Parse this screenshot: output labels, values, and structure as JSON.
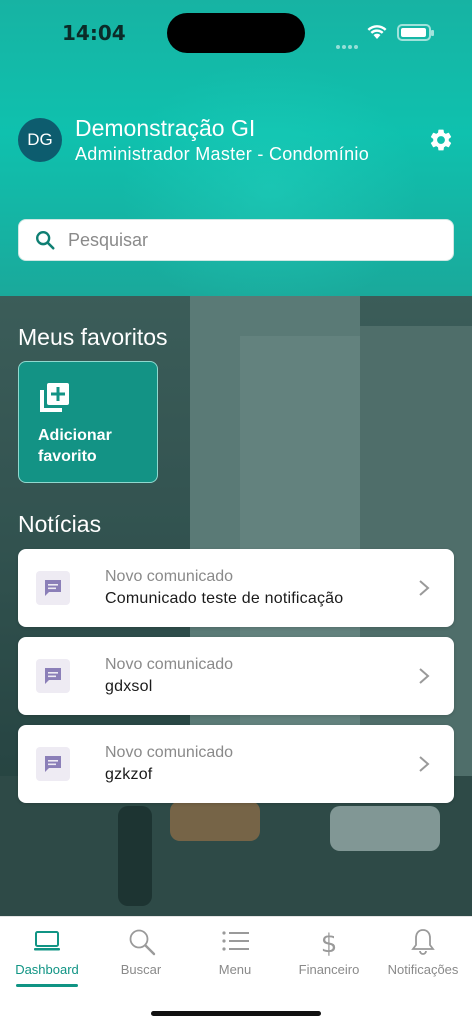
{
  "status_bar": {
    "time": "14:04"
  },
  "header": {
    "avatar_initials": "DG",
    "user_name": "Demonstração GI",
    "user_role": "Administrador Master - Condomínio",
    "settings_icon": "gear-icon"
  },
  "search": {
    "placeholder": "Pesquisar",
    "icon": "search-icon"
  },
  "favorites": {
    "title": "Meus favoritos",
    "add_label": "Adicionar favorito",
    "add_icon": "add-to-list-icon"
  },
  "news": {
    "title": "Notícias",
    "items": [
      {
        "kind": "Novo comunicado",
        "title": "Comunicado teste de notificação"
      },
      {
        "kind": "Novo comunicado",
        "title": "gdxsol"
      },
      {
        "kind": "Novo comunicado",
        "title": "gzkzof"
      }
    ]
  },
  "tabs": [
    {
      "label": "Dashboard",
      "icon": "monitor-icon",
      "active": true
    },
    {
      "label": "Buscar",
      "icon": "search-icon",
      "active": false
    },
    {
      "label": "Menu",
      "icon": "list-icon",
      "active": false
    },
    {
      "label": "Financeiro",
      "icon": "dollar-icon",
      "active": false
    },
    {
      "label": "Notificações",
      "icon": "bell-icon",
      "active": false
    }
  ],
  "colors": {
    "accent": "#109484",
    "header_gradient_top": "#17b3a3",
    "favorite_card": "#139385",
    "avatar": "#0d5c6e",
    "message_icon": "#8b7fb8"
  }
}
